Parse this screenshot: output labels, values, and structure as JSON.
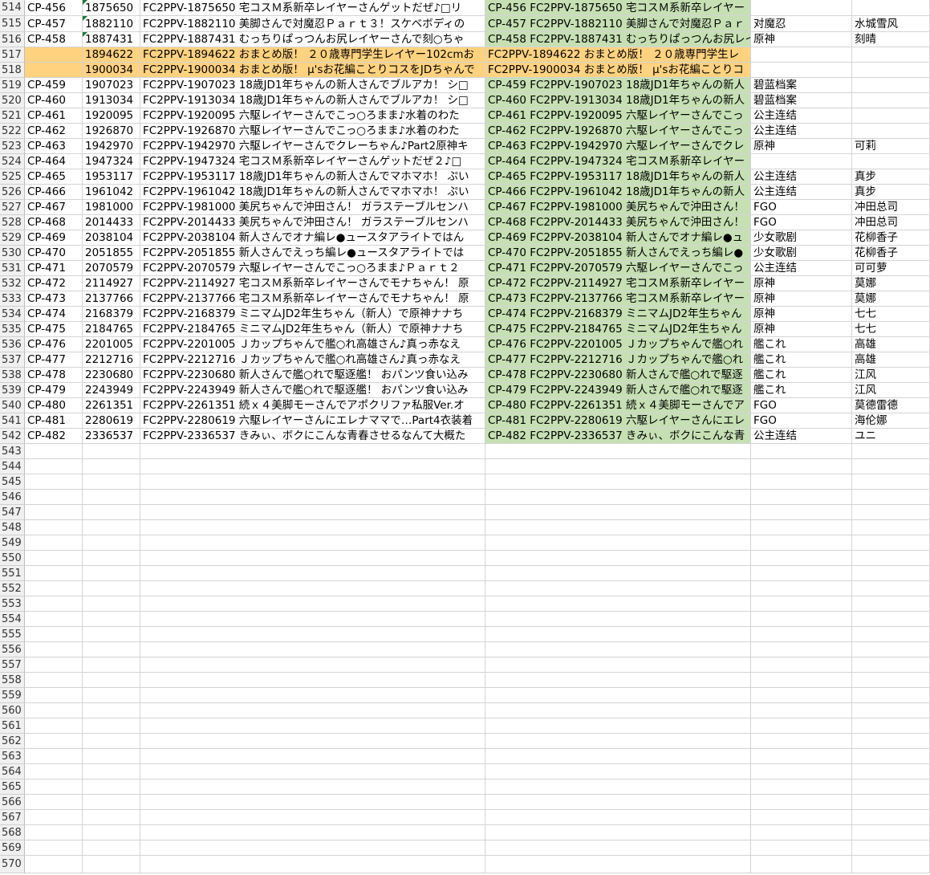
{
  "sheet": {
    "fills": {
      "orange": "#ffd27f",
      "green": "#c6e0b4",
      "header": "#f0f0f0"
    },
    "rows": [
      {
        "num": "514",
        "a": "CP-456",
        "b": "1875650",
        "c": "FC2PPV-1875650 宅コスＭ系新卒レイヤーさんゲットだぜ♪□リ",
        "d": "CP-456 FC2PPV-1875650 宅コスＭ系新卒レイヤー",
        "e": "",
        "f": "",
        "hl": "",
        "tri": true
      },
      {
        "num": "515",
        "a": "CP-457",
        "b": "1882110",
        "c": "FC2PPV-1882110 美脚さんで対魔忍Ｐａｒｔ３！スケベボディの",
        "d": "CP-457 FC2PPV-1882110 美脚さんで対魔忍Ｐａｒ",
        "e": "对魔忍",
        "f": "水城雪风",
        "hl": "",
        "tri": true
      },
      {
        "num": "516",
        "a": "CP-458",
        "b": "1887431",
        "c": "FC2PPV-1887431 むっちりぱっつんお尻レイヤーさんで刻○ちゃ",
        "d": "CP-458 FC2PPV-1887431 むっちりぱっつんお尻レイ",
        "e": "原神",
        "f": "刻晴",
        "hl": "",
        "tri": true
      },
      {
        "num": "517",
        "a": "",
        "b": "1894622",
        "c": "FC2PPV-1894622 おまとめ版！ ２０歳専門学生レイヤー102cmお",
        "d": "FC2PPV-1894622 おまとめ版！ ２０歳専門学生レ",
        "e": "",
        "f": "",
        "hl": "orange",
        "tri": false
      },
      {
        "num": "518",
        "a": "",
        "b": "1900034",
        "c": "FC2PPV-1900034 おまとめ版！ μ'sお花編ことりコスをJDちゃんで",
        "d": "FC2PPV-1900034 おまとめ版！ μ'sお花編ことりコ",
        "e": "",
        "f": "",
        "hl": "orange",
        "tri": false
      },
      {
        "num": "519",
        "a": "CP-459",
        "b": "1907023",
        "c": "FC2PPV-1907023 18歳JD1年ちゃんの新人さんでブルアカ！ シ□",
        "d": "CP-459 FC2PPV-1907023 18歳JD1年ちゃんの新人",
        "e": "碧蓝档案",
        "f": "",
        "hl": "",
        "tri": false
      },
      {
        "num": "520",
        "a": "CP-460",
        "b": "1913034",
        "c": "FC2PPV-1913034 18歳JD1年ちゃんの新人さんでブルアカ！ シ□",
        "d": "CP-460 FC2PPV-1913034 18歳JD1年ちゃんの新人",
        "e": "碧蓝档案",
        "f": "",
        "hl": "",
        "tri": false
      },
      {
        "num": "521",
        "a": "CP-461",
        "b": "1920095",
        "c": "FC2PPV-1920095 六駆レイヤーさんでこっ○ろまま♪水着のわた",
        "d": "CP-461 FC2PPV-1920095 六駆レイヤーさんでこっ",
        "e": "公主连结",
        "f": "",
        "hl": "",
        "tri": false
      },
      {
        "num": "522",
        "a": "CP-462",
        "b": "1926870",
        "c": "FC2PPV-1926870 六駆レイヤーさんでこっ○ろまま♪水着のわた",
        "d": "CP-462 FC2PPV-1926870 六駆レイヤーさんでこっ",
        "e": "公主连结",
        "f": "",
        "hl": "",
        "tri": false
      },
      {
        "num": "523",
        "a": "CP-463",
        "b": "1942970",
        "c": "FC2PPV-1942970 六駆レイヤーさんでクレーちゃん♪Part2原神キ",
        "d": "CP-463 FC2PPV-1942970 六駆レイヤーさんでクレ",
        "e": "原神",
        "f": "可莉",
        "hl": "",
        "tri": false
      },
      {
        "num": "524",
        "a": "CP-464",
        "b": "1947324",
        "c": "FC2PPV-1947324 宅コスＭ系新卒レイヤーさんゲットだぜ２♪□",
        "d": "CP-464 FC2PPV-1947324 宅コスＭ系新卒レイヤー",
        "e": "",
        "f": "",
        "hl": "",
        "tri": false
      },
      {
        "num": "525",
        "a": "CP-465",
        "b": "1953117",
        "c": "FC2PPV-1953117 18歳JD1年ちゃんの新人さんでマホマホ！ ぷい",
        "d": "CP-465 FC2PPV-1953117 18歳JD1年ちゃんの新人",
        "e": "公主连结",
        "f": "真步",
        "hl": "",
        "tri": false
      },
      {
        "num": "526",
        "a": "CP-466",
        "b": "1961042",
        "c": "FC2PPV-1961042 18歳JD1年ちゃんの新人さんでマホマホ！ ぷい",
        "d": "CP-466 FC2PPV-1961042 18歳JD1年ちゃんの新人",
        "e": "公主连结",
        "f": "真步",
        "hl": "",
        "tri": false
      },
      {
        "num": "527",
        "a": "CP-467",
        "b": "1981000",
        "c": "FC2PPV-1981000 美尻ちゃんで沖田さん！ ガラステーブルセンハ",
        "d": "CP-467 FC2PPV-1981000 美尻ちゃんで沖田さん！",
        "e": "FGO",
        "f": "冲田总司",
        "hl": "",
        "tri": false
      },
      {
        "num": "528",
        "a": "CP-468",
        "b": "2014433",
        "c": "FC2PPV-2014433 美尻ちゃんで沖田さん！ ガラステーブルセンハ",
        "d": "CP-468 FC2PPV-2014433 美尻ちゃんで沖田さん！",
        "e": "FGO",
        "f": "冲田总司",
        "hl": "",
        "tri": false
      },
      {
        "num": "529",
        "a": "CP-469",
        "b": "2038104",
        "c": "FC2PPV-2038104 新人さんでオナ編レ●ュースタアライトではん",
        "d": "CP-469 FC2PPV-2038104 新人さんでオナ編レ●ュ",
        "e": "少女歌剧",
        "f": "花柳香子",
        "hl": "",
        "tri": false
      },
      {
        "num": "530",
        "a": "CP-470",
        "b": "2051855",
        "c": "FC2PPV-2051855 新人さんでえっち編レ●ュースタアライトでは",
        "d": "CP-470 FC2PPV-2051855 新人さんでえっち編レ●",
        "e": "少女歌剧",
        "f": "花柳香子",
        "hl": "",
        "tri": false
      },
      {
        "num": "531",
        "a": "CP-471",
        "b": "2070579",
        "c": "FC2PPV-2070579 六駆レイヤーさんでこっ○ろまま♪Ｐａｒｔ２",
        "d": "CP-471 FC2PPV-2070579 六駆レイヤーさんでこっ",
        "e": "公主连结",
        "f": "可可萝",
        "hl": "",
        "tri": false
      },
      {
        "num": "532",
        "a": "CP-472",
        "b": "2114927",
        "c": "FC2PPV-2114927 宅コスＭ系新卒レイヤーさんでモナちゃん！ 原",
        "d": "CP-472 FC2PPV-2114927 宅コスＭ系新卒レイヤー",
        "e": "原神",
        "f": "莫娜",
        "hl": "",
        "tri": false
      },
      {
        "num": "533",
        "a": "CP-473",
        "b": "2137766",
        "c": "FC2PPV-2137766 宅コスＭ系新卒レイヤーさんでモナちゃん！ 原",
        "d": "CP-473 FC2PPV-2137766 宅コスＭ系新卒レイヤー",
        "e": "原神",
        "f": "莫娜",
        "hl": "",
        "tri": false
      },
      {
        "num": "534",
        "a": "CP-474",
        "b": "2168379",
        "c": "FC2PPV-2168379 ミニマムJD2年生ちゃん（新人）で原神ナナち",
        "d": "CP-474 FC2PPV-2168379 ミニマムJD2年生ちゃん",
        "e": "原神",
        "f": "七七",
        "hl": "",
        "tri": false
      },
      {
        "num": "535",
        "a": "CP-475",
        "b": "2184765",
        "c": "FC2PPV-2184765 ミニマムJD2年生ちゃん（新人）で原神ナナち",
        "d": "CP-475 FC2PPV-2184765 ミニマムJD2年生ちゃん",
        "e": "原神",
        "f": "七七",
        "hl": "",
        "tri": false
      },
      {
        "num": "536",
        "a": "CP-476",
        "b": "2201005",
        "c": "FC2PPV-2201005 Ｊカップちゃんで艦○れ高雄さん♪真っ赤なえ",
        "d": "CP-476 FC2PPV-2201005 Ｊカップちゃんで艦○れ",
        "e": "艦これ",
        "f": "高雄",
        "hl": "",
        "tri": false
      },
      {
        "num": "537",
        "a": "CP-477",
        "b": "2212716",
        "c": "FC2PPV-2212716 Ｊカップちゃんで艦○れ高雄さん♪真っ赤なえ",
        "d": "CP-477 FC2PPV-2212716 Ｊカップちゃんで艦○れ",
        "e": "艦これ",
        "f": "高雄",
        "hl": "",
        "tri": false
      },
      {
        "num": "538",
        "a": "CP-478",
        "b": "2230680",
        "c": "FC2PPV-2230680 新人さんで艦○れで駆逐艦！ おパンツ食い込み",
        "d": "CP-478 FC2PPV-2230680 新人さんで艦○れで駆逐",
        "e": "艦これ",
        "f": "江风",
        "hl": "",
        "tri": false
      },
      {
        "num": "539",
        "a": "CP-479",
        "b": "2243949",
        "c": "FC2PPV-2243949 新人さんで艦○れで駆逐艦！ おパンツ食い込み",
        "d": "CP-479 FC2PPV-2243949 新人さんで艦○れで駆逐",
        "e": "艦これ",
        "f": "江风",
        "hl": "",
        "tri": false
      },
      {
        "num": "540",
        "a": "CP-480",
        "b": "2261351",
        "c": "FC2PPV-2261351 続ｘ４美脚モーさんでアポクリファ私服Ver.オ",
        "d": "CP-480 FC2PPV-2261351 続ｘ４美脚モーさんでア",
        "e": "FGO",
        "f": "莫德雷德",
        "hl": "",
        "tri": false
      },
      {
        "num": "541",
        "a": "CP-481",
        "b": "2280619",
        "c": "FC2PPV-2280619 六駆レイヤーさんにエレナママで…Part4衣装着",
        "d": "CP-481 FC2PPV-2280619 六駆レイヤーさんにエレ",
        "e": "FGO",
        "f": "海伦娜",
        "hl": "",
        "tri": false
      },
      {
        "num": "542",
        "a": "CP-482",
        "b": "2336537",
        "c": "FC2PPV-2336537 きみぃ、ボクにこんな青春させるなんて大概た",
        "d": "CP-482 FC2PPV-2336537 きみぃ、ボクにこんな青",
        "e": "公主连结",
        "f": "ユニ",
        "hl": "",
        "tri": false
      },
      {
        "num": "543",
        "a": "",
        "b": "",
        "c": "",
        "d": "",
        "e": "",
        "f": "",
        "hl": "",
        "tri": false
      },
      {
        "num": "544",
        "a": "",
        "b": "",
        "c": "",
        "d": "",
        "e": "",
        "f": "",
        "hl": "",
        "tri": false
      },
      {
        "num": "545",
        "a": "",
        "b": "",
        "c": "",
        "d": "",
        "e": "",
        "f": "",
        "hl": "",
        "tri": false
      },
      {
        "num": "546",
        "a": "",
        "b": "",
        "c": "",
        "d": "",
        "e": "",
        "f": "",
        "hl": "",
        "tri": false
      },
      {
        "num": "547",
        "a": "",
        "b": "",
        "c": "",
        "d": "",
        "e": "",
        "f": "",
        "hl": "",
        "tri": false
      },
      {
        "num": "548",
        "a": "",
        "b": "",
        "c": "",
        "d": "",
        "e": "",
        "f": "",
        "hl": "",
        "tri": false
      },
      {
        "num": "549",
        "a": "",
        "b": "",
        "c": "",
        "d": "",
        "e": "",
        "f": "",
        "hl": "",
        "tri": false
      },
      {
        "num": "550",
        "a": "",
        "b": "",
        "c": "",
        "d": "",
        "e": "",
        "f": "",
        "hl": "",
        "tri": false
      },
      {
        "num": "551",
        "a": "",
        "b": "",
        "c": "",
        "d": "",
        "e": "",
        "f": "",
        "hl": "",
        "tri": false
      },
      {
        "num": "552",
        "a": "",
        "b": "",
        "c": "",
        "d": "",
        "e": "",
        "f": "",
        "hl": "",
        "tri": false
      },
      {
        "num": "553",
        "a": "",
        "b": "",
        "c": "",
        "d": "",
        "e": "",
        "f": "",
        "hl": "",
        "tri": false
      },
      {
        "num": "554",
        "a": "",
        "b": "",
        "c": "",
        "d": "",
        "e": "",
        "f": "",
        "hl": "",
        "tri": false
      },
      {
        "num": "555",
        "a": "",
        "b": "",
        "c": "",
        "d": "",
        "e": "",
        "f": "",
        "hl": "",
        "tri": false
      },
      {
        "num": "556",
        "a": "",
        "b": "",
        "c": "",
        "d": "",
        "e": "",
        "f": "",
        "hl": "",
        "tri": false
      },
      {
        "num": "557",
        "a": "",
        "b": "",
        "c": "",
        "d": "",
        "e": "",
        "f": "",
        "hl": "",
        "tri": false
      },
      {
        "num": "558",
        "a": "",
        "b": "",
        "c": "",
        "d": "",
        "e": "",
        "f": "",
        "hl": "",
        "tri": false
      },
      {
        "num": "559",
        "a": "",
        "b": "",
        "c": "",
        "d": "",
        "e": "",
        "f": "",
        "hl": "",
        "tri": false
      },
      {
        "num": "560",
        "a": "",
        "b": "",
        "c": "",
        "d": "",
        "e": "",
        "f": "",
        "hl": "",
        "tri": false
      },
      {
        "num": "561",
        "a": "",
        "b": "",
        "c": "",
        "d": "",
        "e": "",
        "f": "",
        "hl": "",
        "tri": false
      },
      {
        "num": "562",
        "a": "",
        "b": "",
        "c": "",
        "d": "",
        "e": "",
        "f": "",
        "hl": "",
        "tri": false
      },
      {
        "num": "563",
        "a": "",
        "b": "",
        "c": "",
        "d": "",
        "e": "",
        "f": "",
        "hl": "",
        "tri": false
      },
      {
        "num": "564",
        "a": "",
        "b": "",
        "c": "",
        "d": "",
        "e": "",
        "f": "",
        "hl": "",
        "tri": false
      },
      {
        "num": "565",
        "a": "",
        "b": "",
        "c": "",
        "d": "",
        "e": "",
        "f": "",
        "hl": "",
        "tri": false
      },
      {
        "num": "566",
        "a": "",
        "b": "",
        "c": "",
        "d": "",
        "e": "",
        "f": "",
        "hl": "",
        "tri": false
      },
      {
        "num": "567",
        "a": "",
        "b": "",
        "c": "",
        "d": "",
        "e": "",
        "f": "",
        "hl": "",
        "tri": false
      },
      {
        "num": "568",
        "a": "",
        "b": "",
        "c": "",
        "d": "",
        "e": "",
        "f": "",
        "hl": "",
        "tri": false
      },
      {
        "num": "569",
        "a": "",
        "b": "",
        "c": "",
        "d": "",
        "e": "",
        "f": "",
        "hl": "",
        "tri": false
      },
      {
        "num": "570",
        "a": "",
        "b": "",
        "c": "",
        "d": "",
        "e": "",
        "f": "",
        "hl": "",
        "tri": false
      }
    ]
  }
}
